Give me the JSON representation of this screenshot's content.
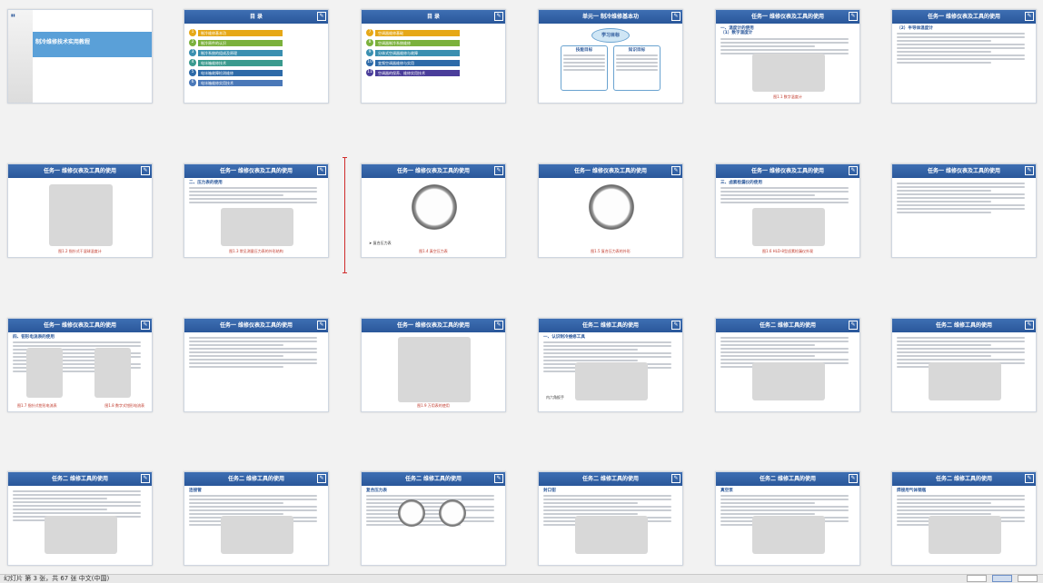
{
  "slides": [
    {
      "id": 1,
      "type": "title",
      "title": "制冷维修技术实用教程"
    },
    {
      "id": 2,
      "type": "toc",
      "header": "目  录",
      "items": [
        {
          "num": "1",
          "label": "制冷维修基本功",
          "color": "#e6a817"
        },
        {
          "num": "2",
          "label": "制冷原件的认识",
          "color": "#7bb13c"
        },
        {
          "num": "3",
          "label": "制冷系统的组成及原理",
          "color": "#3a8fb0"
        },
        {
          "num": "4",
          "label": "电冰箱维修技术",
          "color": "#3a9a8e"
        },
        {
          "num": "5",
          "label": "电冰箱故障检测维修",
          "color": "#2d6aa8"
        },
        {
          "num": "6",
          "label": "电冰箱维修实用技术",
          "color": "#4a78b8"
        }
      ]
    },
    {
      "id": 3,
      "type": "toc",
      "header": "目  录",
      "items": [
        {
          "num": "7",
          "label": "空调器维修基础",
          "color": "#e6a817"
        },
        {
          "num": "8",
          "label": "空调器制冷系统维修",
          "color": "#7bb13c"
        },
        {
          "num": "9",
          "label": "分体式空调器维修与故障",
          "color": "#3a8fb0"
        },
        {
          "num": "10",
          "label": "变频空调器维修与实用",
          "color": "#2d6aa8"
        },
        {
          "num": "11",
          "label": "空调器的保养、维修实用技术",
          "color": "#4a3d9a"
        }
      ]
    },
    {
      "id": 4,
      "header": "单元一 制冷维修基本功",
      "goal": "学习目标",
      "left_title": "技能目标",
      "right_title": "知识目标"
    },
    {
      "id": 5,
      "header": "任务一 维修仪表及工具的使用",
      "sub1": "一、温度计的使用",
      "sub2": "（1）数字温度计",
      "caption": "图1.1 数字温度计"
    },
    {
      "id": 6,
      "header": "任务一 维修仪表及工具的使用",
      "sub1": "（2）半导体温度计"
    },
    {
      "id": 7,
      "header": "任务一 维修仪表及工具的使用",
      "caption": "图1.2 指针式干湿球温度计"
    },
    {
      "id": 8,
      "header": "任务一 维修仪表及工具的使用",
      "sub1": "二、压力表的使用",
      "caption": "图1.3 常见测量压力表的外形结构"
    },
    {
      "id": 9,
      "header": "任务一 维修仪表及工具的使用",
      "caption": "图1.4 真空压力表",
      "note": "➤ 复合压力表"
    },
    {
      "id": 10,
      "header": "任务一 维修仪表及工具的使用",
      "caption": "图1.5 复合压力表的外形"
    },
    {
      "id": 11,
      "header": "任务一 维修仪表及工具的使用",
      "sub1": "三、卤素检漏仪的使用",
      "caption": "图1.6 HLD-8型卤素检漏仪外观"
    },
    {
      "id": 12,
      "header": "任务一 维修仪表及工具的使用"
    },
    {
      "id": 13,
      "header": "任务一 维修仪表及工具的使用",
      "sub1": "四、钳形电流表的使用",
      "caption1": "图1.7 指针式钳形电流表",
      "caption2": "图1.8 数字式钳形电流表"
    },
    {
      "id": 14,
      "header": "任务一 维修仪表及工具的使用"
    },
    {
      "id": 15,
      "header": "任务一 维修仪表及工具的使用",
      "caption": "图1.9 万用表的使用"
    },
    {
      "id": 16,
      "header": "任务二 维修工具的使用",
      "sub1": "一、认识制冷维修工具",
      "note": "内六角扳手"
    },
    {
      "id": 17,
      "header": "任务二 维修工具的使用"
    },
    {
      "id": 18,
      "header": "任务二 维修工具的使用"
    },
    {
      "id": 19,
      "header": "任务二 维修工具的使用"
    },
    {
      "id": 20,
      "header": "任务二 维修工具的使用",
      "sub1": "连接管"
    },
    {
      "id": 21,
      "header": "任务二 维修工具的使用",
      "sub1": "复合压力表"
    },
    {
      "id": 22,
      "header": "任务二 维修工具的使用",
      "sub1": "封口钳"
    },
    {
      "id": 23,
      "header": "任务二 维修工具的使用",
      "sub1": "真空泵"
    },
    {
      "id": 24,
      "header": "任务二 维修工具的使用",
      "sub1": "焊接用气体钢瓶"
    }
  ],
  "statusbar": {
    "left": "幻灯片 第 3 张，共 67 张   中文(中国)"
  },
  "colors": {
    "header": "#2a579a",
    "caption": "#c0392b",
    "accent": "#5aa0d8"
  }
}
